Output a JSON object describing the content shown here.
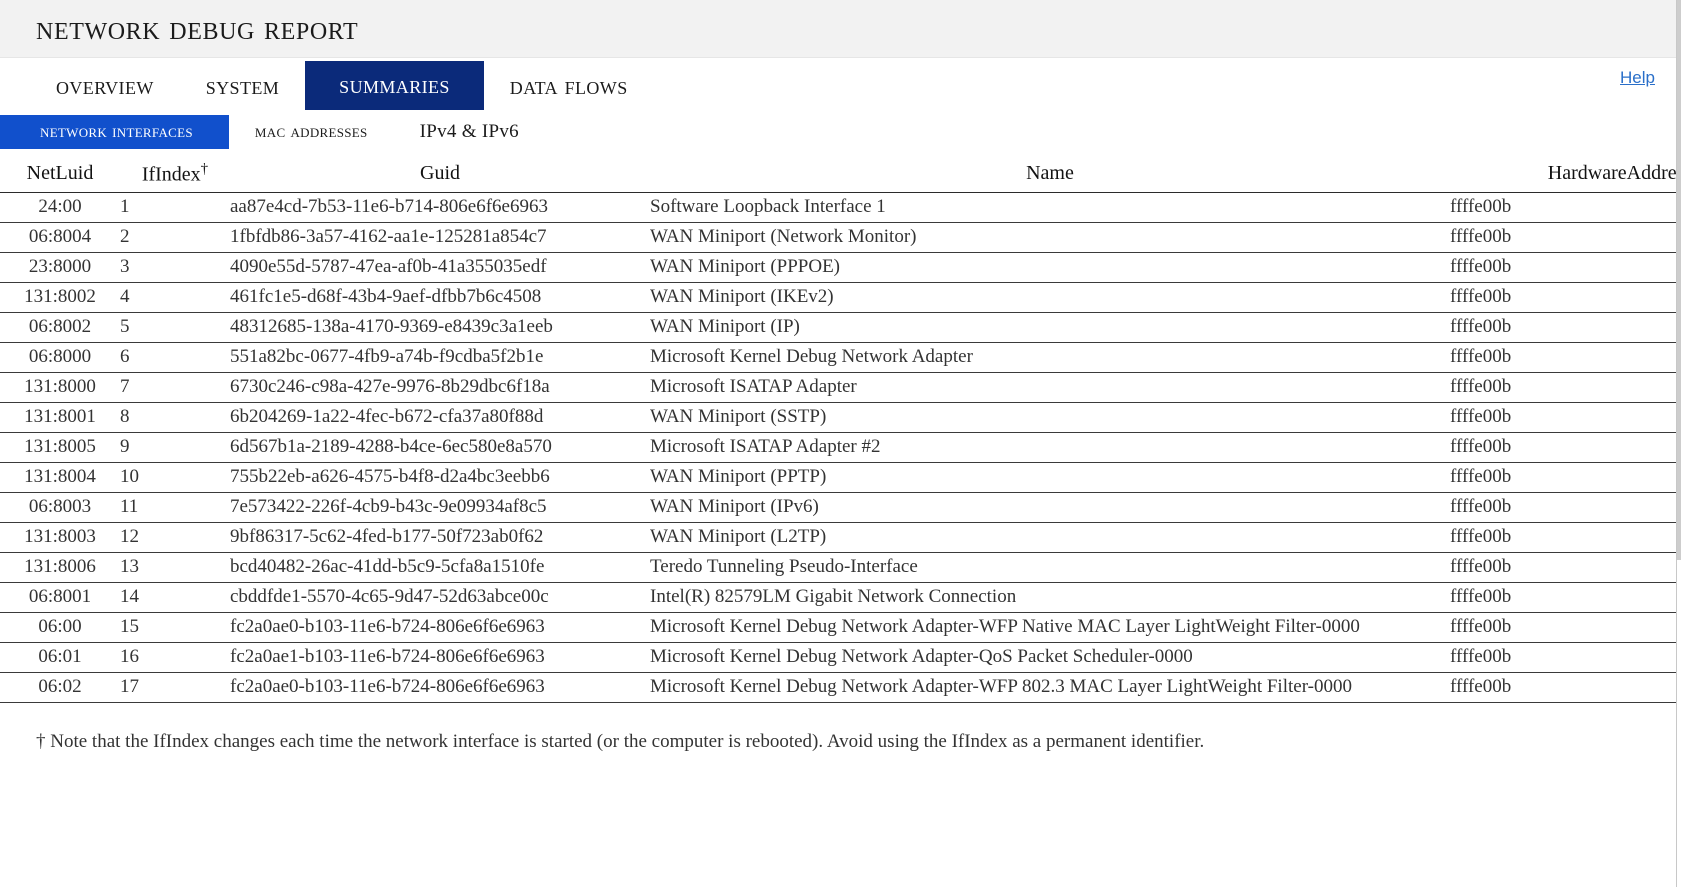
{
  "header": {
    "title": "Network Debug Report",
    "help_label": "Help"
  },
  "tabs": [
    {
      "label": "Overview",
      "active": false
    },
    {
      "label": "System",
      "active": false
    },
    {
      "label": "Summaries",
      "active": true
    },
    {
      "label": "Data flows",
      "active": false
    }
  ],
  "subtabs": [
    {
      "label": "Network interfaces",
      "active": true,
      "smallcaps": true
    },
    {
      "label": "MAC Addresses",
      "active": false,
      "smallcaps": true
    },
    {
      "label": "IPv4 & IPv6",
      "active": false,
      "smallcaps": false
    }
  ],
  "table": {
    "columns": [
      "NetLuid",
      "IfIndex",
      "Guid",
      "Name",
      "HardwareAddress"
    ],
    "ifindex_header_marker": "†",
    "hardware_header_visible": "Ha",
    "rows": [
      {
        "netluid": "24:00",
        "ifindex": "1",
        "guid": "aa87e4cd-7b53-11e6-b714-806e6f6e6963",
        "name": "Software Loopback Interface 1",
        "hardware": "ffffe00b"
      },
      {
        "netluid": "06:8004",
        "ifindex": "2",
        "guid": "1fbfdb86-3a57-4162-aa1e-125281a854c7",
        "name": "WAN Miniport (Network Monitor)",
        "hardware": "ffffe00b"
      },
      {
        "netluid": "23:8000",
        "ifindex": "3",
        "guid": "4090e55d-5787-47ea-af0b-41a355035edf",
        "name": "WAN Miniport (PPPOE)",
        "hardware": "ffffe00b"
      },
      {
        "netluid": "131:8002",
        "ifindex": "4",
        "guid": "461fc1e5-d68f-43b4-9aef-dfbb7b6c4508",
        "name": "WAN Miniport (IKEv2)",
        "hardware": "ffffe00b"
      },
      {
        "netluid": "06:8002",
        "ifindex": "5",
        "guid": "48312685-138a-4170-9369-e8439c3a1eeb",
        "name": "WAN Miniport (IP)",
        "hardware": "ffffe00b"
      },
      {
        "netluid": "06:8000",
        "ifindex": "6",
        "guid": "551a82bc-0677-4fb9-a74b-f9cdba5f2b1e",
        "name": "Microsoft Kernel Debug Network Adapter",
        "hardware": "ffffe00b"
      },
      {
        "netluid": "131:8000",
        "ifindex": "7",
        "guid": "6730c246-c98a-427e-9976-8b29dbc6f18a",
        "name": "Microsoft ISATAP Adapter",
        "hardware": "ffffe00b"
      },
      {
        "netluid": "131:8001",
        "ifindex": "8",
        "guid": "6b204269-1a22-4fec-b672-cfa37a80f88d",
        "name": "WAN Miniport (SSTP)",
        "hardware": "ffffe00b"
      },
      {
        "netluid": "131:8005",
        "ifindex": "9",
        "guid": "6d567b1a-2189-4288-b4ce-6ec580e8a570",
        "name": "Microsoft ISATAP Adapter #2",
        "hardware": "ffffe00b"
      },
      {
        "netluid": "131:8004",
        "ifindex": "10",
        "guid": "755b22eb-a626-4575-b4f8-d2a4bc3eebb6",
        "name": "WAN Miniport (PPTP)",
        "hardware": "ffffe00b"
      },
      {
        "netluid": "06:8003",
        "ifindex": "11",
        "guid": "7e573422-226f-4cb9-b43c-9e09934af8c5",
        "name": "WAN Miniport (IPv6)",
        "hardware": "ffffe00b"
      },
      {
        "netluid": "131:8003",
        "ifindex": "12",
        "guid": "9bf86317-5c62-4fed-b177-50f723ab0f62",
        "name": "WAN Miniport (L2TP)",
        "hardware": "ffffe00b"
      },
      {
        "netluid": "131:8006",
        "ifindex": "13",
        "guid": "bcd40482-26ac-41dd-b5c9-5cfa8a1510fe",
        "name": "Teredo Tunneling Pseudo-Interface",
        "hardware": "ffffe00b"
      },
      {
        "netluid": "06:8001",
        "ifindex": "14",
        "guid": "cbddfde1-5570-4c65-9d47-52d63abce00c",
        "name": "Intel(R) 82579LM Gigabit Network Connection",
        "hardware": "ffffe00b"
      },
      {
        "netluid": "06:00",
        "ifindex": "15",
        "guid": "fc2a0ae0-b103-11e6-b724-806e6f6e6963",
        "name": "Microsoft Kernel Debug Network Adapter-WFP Native MAC Layer LightWeight Filter-0000",
        "hardware": "ffffe00b"
      },
      {
        "netluid": "06:01",
        "ifindex": "16",
        "guid": "fc2a0ae1-b103-11e6-b724-806e6f6e6963",
        "name": "Microsoft Kernel Debug Network Adapter-QoS Packet Scheduler-0000",
        "hardware": "ffffe00b"
      },
      {
        "netluid": "06:02",
        "ifindex": "17",
        "guid": "fc2a0ae0-b103-11e6-b724-806e6f6e6963",
        "name": "Microsoft Kernel Debug Network Adapter-WFP 802.3 MAC Layer LightWeight Filter-0000",
        "hardware": "ffffe00b"
      }
    ]
  },
  "footnote": "† Note that the IfIndex changes each time the network interface is started (or the computer is rebooted). Avoid using the IfIndex as a permanent identifier.",
  "colors": {
    "title_band": "#f2f2f2",
    "active_tab": "#0b2a7a",
    "active_subtab": "#1150cc",
    "link": "#2a6fc9",
    "text": "#333333"
  }
}
